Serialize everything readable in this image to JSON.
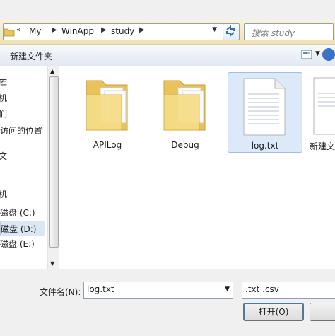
{
  "address_bar": {
    "path": [
      "My",
      "WinApp",
      "study"
    ],
    "prefix": "«"
  },
  "search": {
    "placeholder": "搜索 study"
  },
  "toolbar": {
    "new_folder_label": "新建文件夹"
  },
  "nav": {
    "items": [
      {
        "label": "库"
      },
      {
        "label": "机"
      },
      {
        "label": "们"
      },
      {
        "label": "访问的位置"
      },
      {
        "label": "文"
      },
      {
        "label": "机"
      },
      {
        "label": "磁盘 (C:)"
      },
      {
        "label": "磁盘 (D:)",
        "selected": true
      },
      {
        "label": "磁盘 (E:)"
      }
    ]
  },
  "files": [
    {
      "name": "APILog",
      "type": "folder"
    },
    {
      "name": "Debug",
      "type": "folder"
    },
    {
      "name": "log.txt",
      "type": "text",
      "selected": true
    },
    {
      "name": "新建文",
      "type": "text"
    }
  ],
  "bottom": {
    "filename_label": "文件名(N):",
    "filename_value": "log.txt",
    "filter_value": ".txt .csv",
    "open_label": "打开(O)"
  },
  "colors": {
    "selection": "#dce9f8",
    "toolbar_bg": "#e3e9f2",
    "folder": "#f3d67a"
  }
}
